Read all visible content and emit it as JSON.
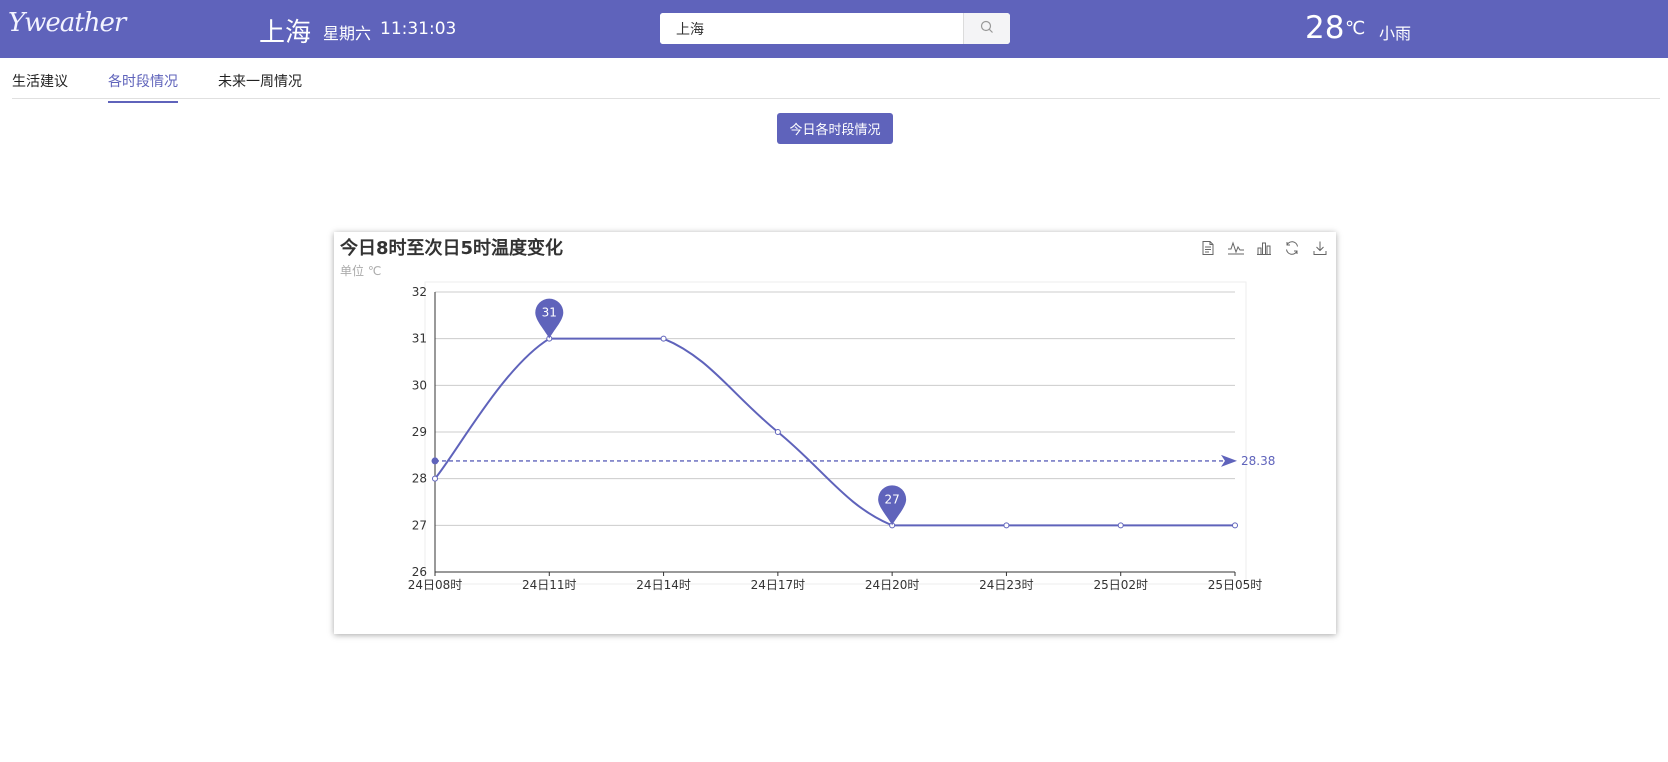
{
  "header": {
    "logo": "Yweather",
    "city": "上海",
    "weekday": "星期六",
    "time": "11:31:03",
    "search": {
      "value": "上海",
      "placeholder": ""
    },
    "current_temp": "28",
    "temp_unit": "℃",
    "condition": "小雨"
  },
  "tabs": [
    {
      "label": "生活建议"
    },
    {
      "label": "各时段情况"
    },
    {
      "label": "未来一周情况"
    }
  ],
  "today_button": "今日各时段情况",
  "colors": {
    "accent": "#5f63bb",
    "header_bg": "#5f63bb"
  },
  "chart_data": {
    "type": "line",
    "title": "今日8时至次日5时温度变化",
    "subtitle": "单位 ℃",
    "categories": [
      "24日08时",
      "24日11时",
      "24日14时",
      "24日17时",
      "24日20时",
      "24日23时",
      "25日02时",
      "25日05时"
    ],
    "series": [
      {
        "values": [
          28,
          31,
          31,
          29,
          27,
          27,
          27,
          27
        ],
        "smooth": true
      }
    ],
    "mark_points": [
      {
        "label": "31",
        "category_index": 1,
        "value": 31
      },
      {
        "label": "27",
        "category_index": 4,
        "value": 27
      }
    ],
    "mark_line": {
      "value": 28.38,
      "label": "28.38",
      "type": "average"
    },
    "yticks": [
      "26",
      "27",
      "28",
      "29",
      "30",
      "31",
      "32"
    ],
    "ylim": [
      26,
      32
    ],
    "grid": true,
    "color": "#5f63bb",
    "toolbox": [
      "data-view-icon",
      "line-chart-icon",
      "bar-chart-icon",
      "restore-icon",
      "download-icon"
    ]
  }
}
